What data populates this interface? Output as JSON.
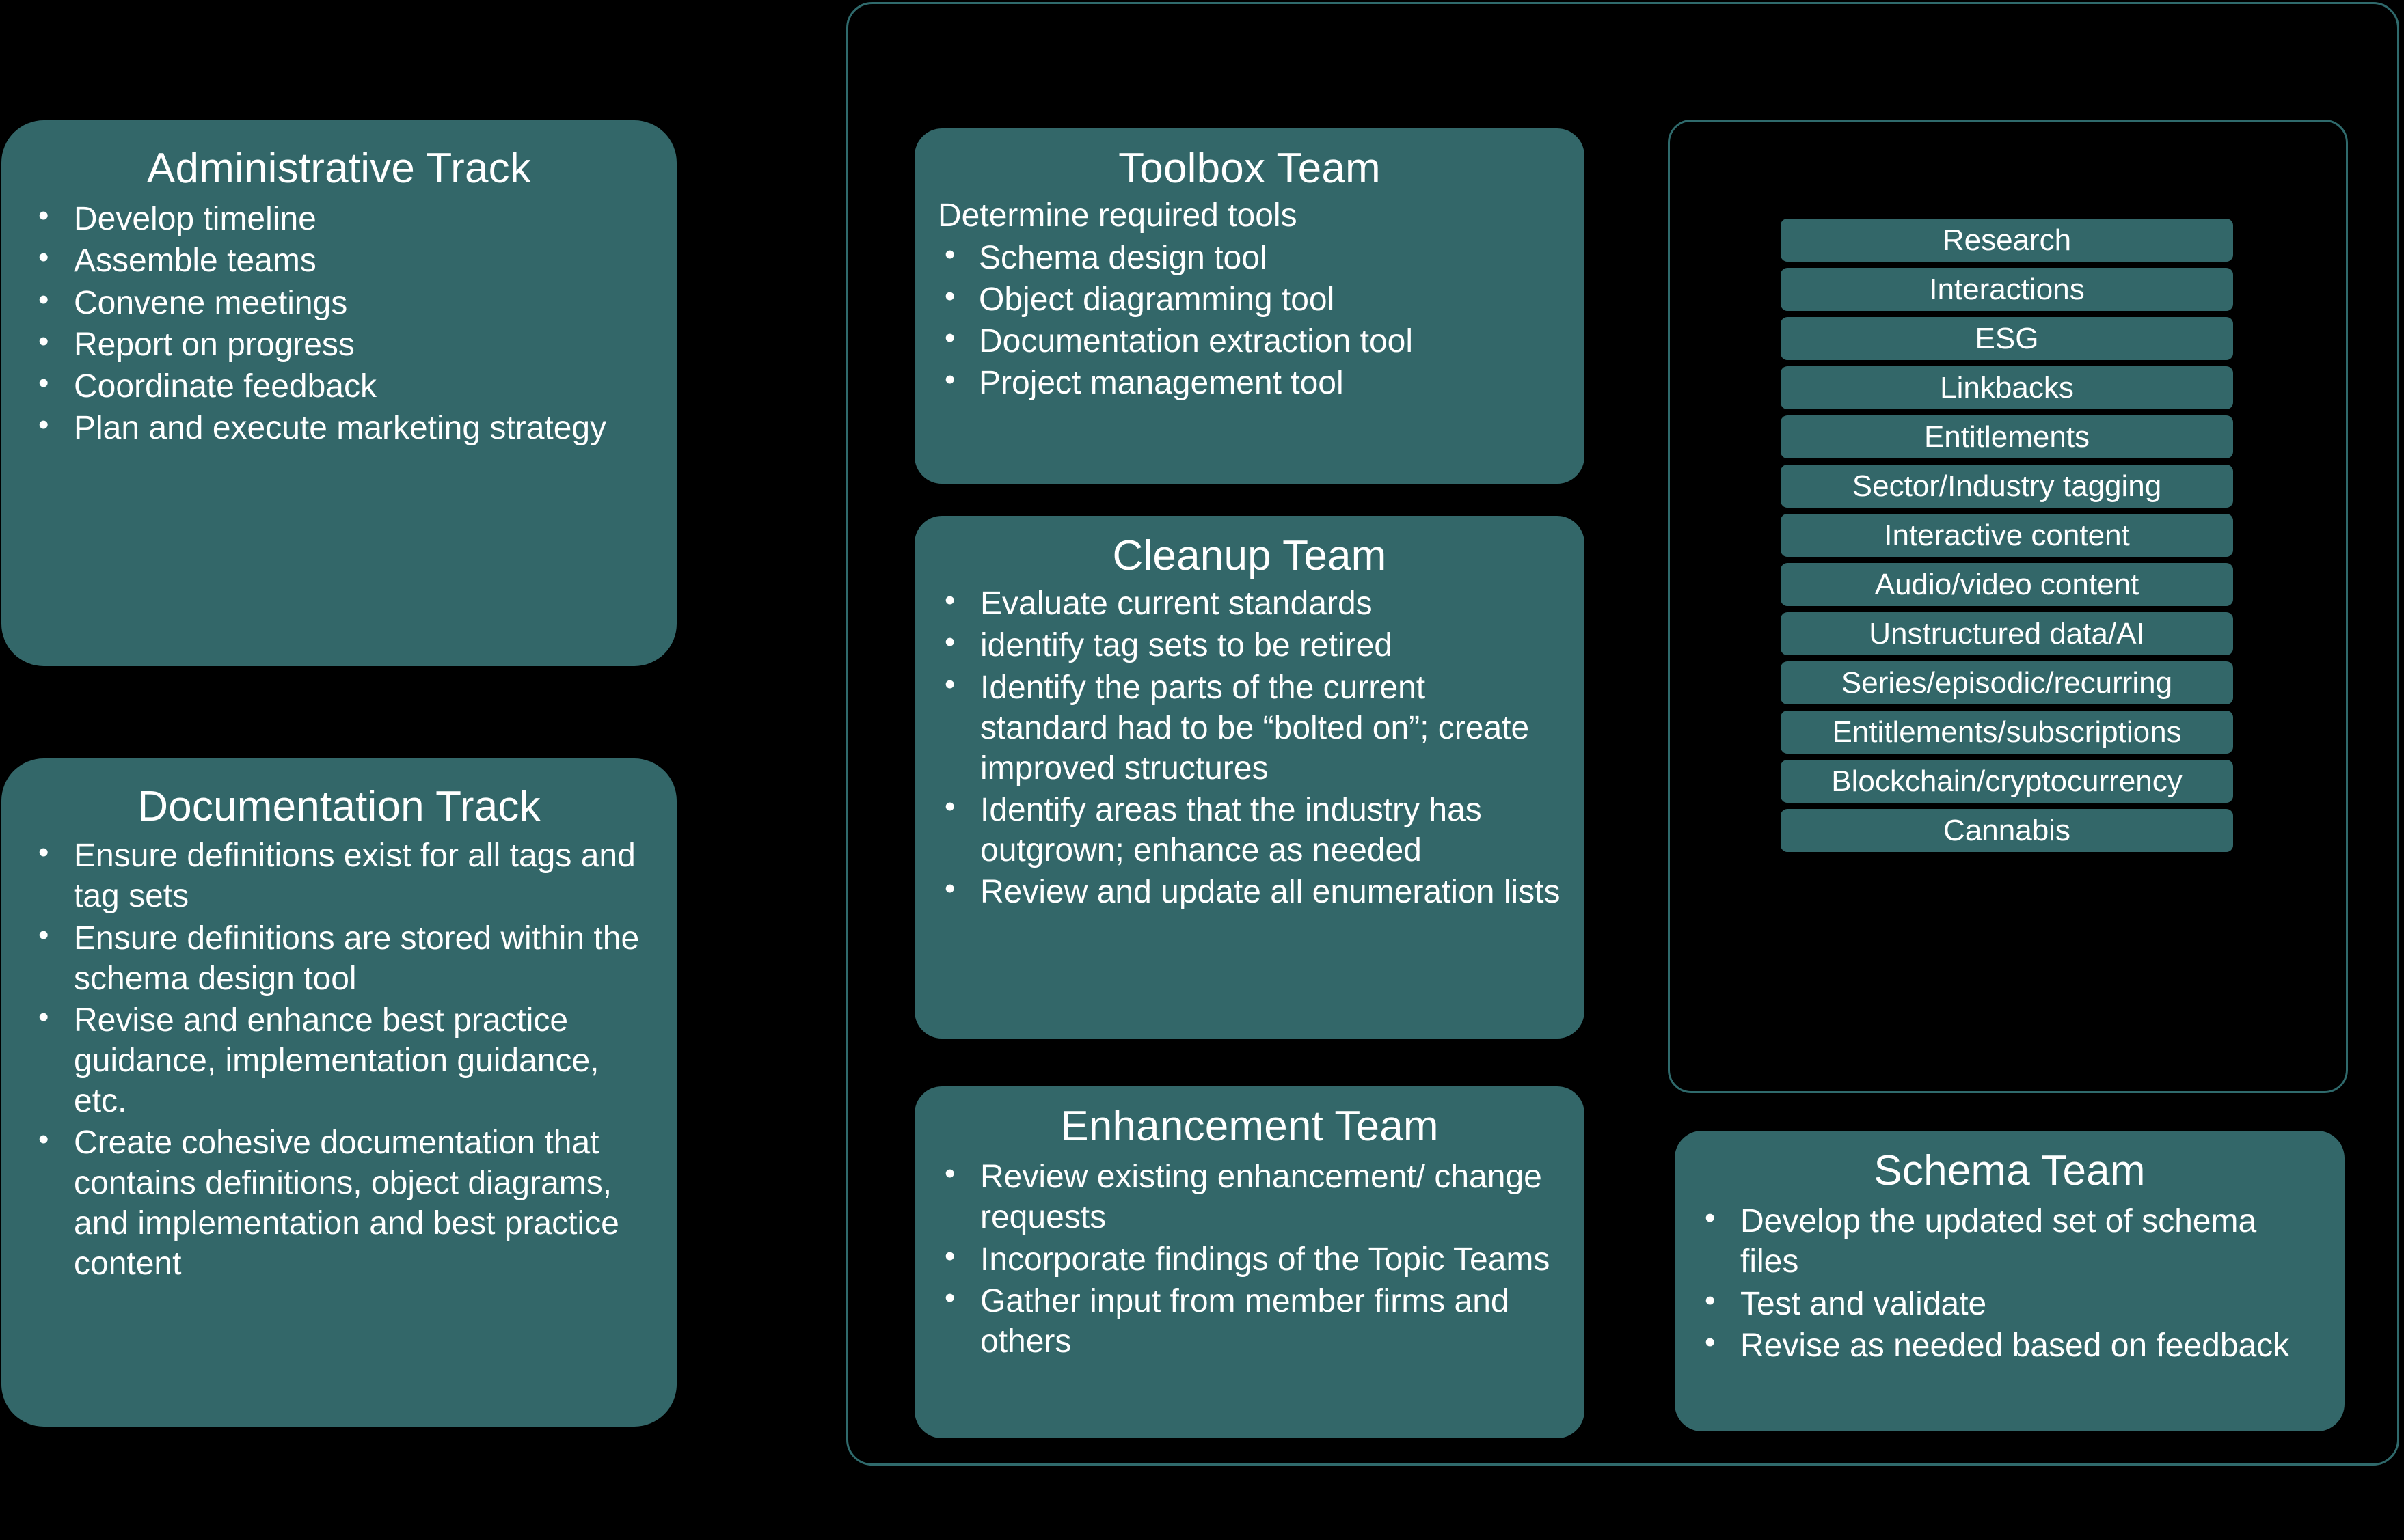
{
  "theme": {
    "background": "#000000",
    "card_fill": "#336769",
    "card_text": "#ffffff",
    "outline_stroke": "#2f6a6c"
  },
  "left_column": {
    "administrative_track": {
      "title": "Administrative Track",
      "bullets": [
        "Develop timeline",
        "Assemble teams",
        "Convene meetings",
        "Report on progress",
        "Coordinate feedback",
        "Plan and execute marketing strategy"
      ]
    },
    "documentation_track": {
      "title": "Documentation Track",
      "bullets": [
        "Ensure definitions exist for all tags and tag sets",
        "Ensure definitions are stored within the schema design tool",
        "Revise and enhance best practice guidance, implementation guidance, etc.",
        "Create cohesive documentation that contains definitions, object diagrams, and implementation and best practice content"
      ]
    }
  },
  "teams": {
    "toolbox_team": {
      "title": "Toolbox Team",
      "lead": "Determine required tools",
      "bullets": [
        "Schema design tool",
        "Object diagramming tool",
        "Documentation extraction tool",
        "Project management tool"
      ]
    },
    "cleanup_team": {
      "title": "Cleanup Team",
      "bullets": [
        "Evaluate current standards",
        "identify tag sets to be retired",
        "Identify the parts of the current standard had to be “bolted on”; create improved structures",
        "Identify areas that the industry has outgrown; enhance as needed",
        "Review and update all enumeration lists"
      ]
    },
    "enhancement_team": {
      "title": "Enhancement Team",
      "bullets": [
        "Review existing enhancement/ change requests",
        "Incorporate findings of the Topic Teams",
        "Gather input from member firms and others"
      ]
    },
    "schema_team": {
      "title": "Schema Team",
      "bullets": [
        "Develop the updated set of schema files",
        "Test and validate",
        "Revise as needed based on feedback"
      ]
    }
  },
  "topic_teams": {
    "items": [
      "Research",
      "Interactions",
      "ESG",
      "Linkbacks",
      "Entitlements",
      "Sector/Industry tagging",
      "Interactive content",
      "Audio/video content",
      "Unstructured data/AI",
      "Series/episodic/recurring",
      "Entitlements/subscriptions",
      "Blockchain/cryptocurrency",
      "Cannabis"
    ]
  }
}
